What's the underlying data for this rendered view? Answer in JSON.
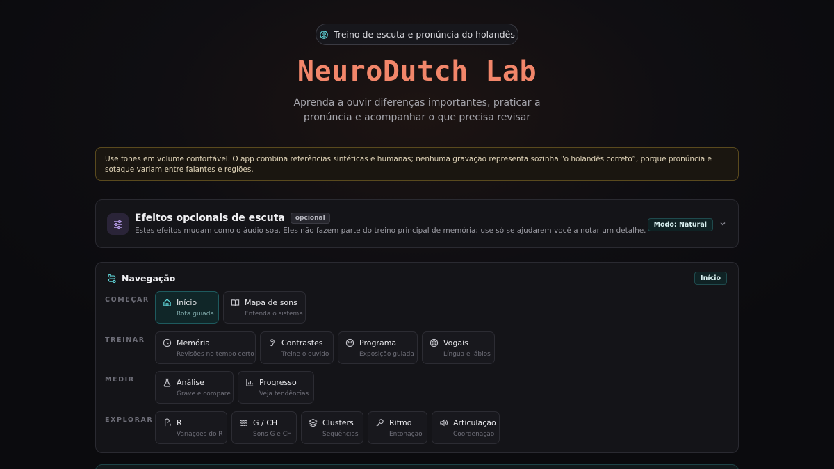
{
  "header": {
    "pill": "Treino de escuta e pronúncia do holandês",
    "title": "NeuroDutch Lab",
    "subtitle": "Aprenda a ouvir diferenças importantes, praticar a pronúncia e acompanhar o que precisa revisar"
  },
  "notice": "Use fones em volume confortável. O app combina referências sintéticas e humanas; nenhuma gravação representa sozinha “o holandês correto”, porque pronúncia e sotaque variam entre falantes e regiões.",
  "effects": {
    "title": "Efeitos opcionais de escuta",
    "badge": "opcional",
    "description": "Estes efeitos mudam como o áudio soa. Eles não fazem parte do treino principal de memória; use só se ajudarem você a notar um detalhe.",
    "mode": "Modo: Natural"
  },
  "nav": {
    "title": "Navegação",
    "current": "Início",
    "groups": [
      {
        "label": "COMEÇAR",
        "items": [
          {
            "label": "Início",
            "sub": "Rota guiada",
            "icon": "home-icon",
            "active": true
          },
          {
            "label": "Mapa de sons",
            "sub": "Entenda o sistema",
            "icon": "book-icon"
          }
        ]
      },
      {
        "label": "TREINAR",
        "items": [
          {
            "label": "Memória",
            "sub": "Revisões no tempo certo",
            "icon": "clock-icon"
          },
          {
            "label": "Contrastes",
            "sub": "Treine o ouvido",
            "icon": "ear-icon"
          },
          {
            "label": "Programa",
            "sub": "Exposição guiada",
            "icon": "brain-icon"
          },
          {
            "label": "Vogais",
            "sub": "Língua e lábios",
            "icon": "target-icon"
          }
        ]
      },
      {
        "label": "MEDIR",
        "items": [
          {
            "label": "Análise",
            "sub": "Grave e compare",
            "icon": "flask-icon"
          },
          {
            "label": "Progresso",
            "sub": "Veja tendências",
            "icon": "bar-chart-icon"
          }
        ]
      },
      {
        "label": "EXPLORAR",
        "items": [
          {
            "label": "R",
            "sub": "Variações do R",
            "icon": "r-sound-icon"
          },
          {
            "label": "G / CH",
            "sub": "Sons G e CH",
            "icon": "waves-icon"
          },
          {
            "label": "Clusters",
            "sub": "Sequências",
            "icon": "layers-icon"
          },
          {
            "label": "Ritmo",
            "sub": "Entonação",
            "icon": "music-icon"
          },
          {
            "label": "Articulação",
            "sub": "Coordenação",
            "icon": "speaker-icon"
          }
        ]
      }
    ]
  },
  "colors": {
    "accent": "#f2866a",
    "teal": "#5fd3d6",
    "warning_border": "#5a4a1e"
  }
}
